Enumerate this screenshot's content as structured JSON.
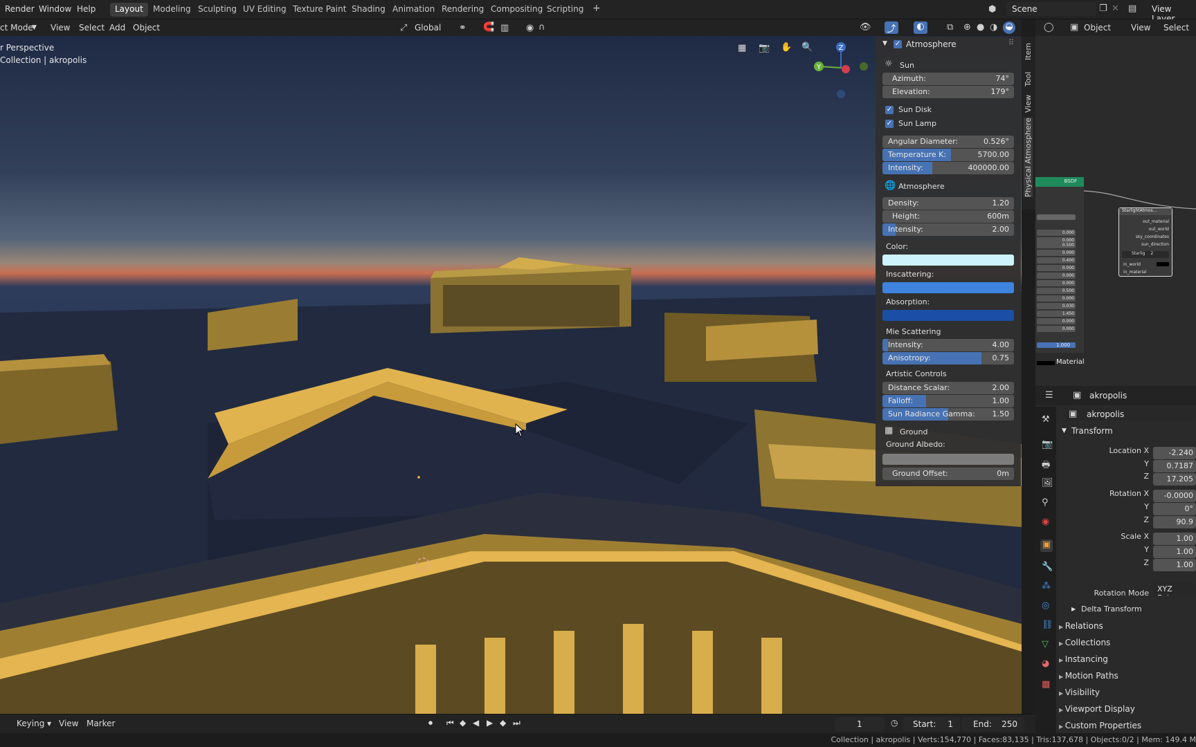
{
  "menu": [
    "Render",
    "Window",
    "Help"
  ],
  "workspaces": [
    "Layout",
    "Modeling",
    "Sculpting",
    "UV Editing",
    "Texture Paint",
    "Shading",
    "Animation",
    "Rendering",
    "Compositing",
    "Scripting"
  ],
  "active_workspace": "Layout",
  "add_tab": "+",
  "scene": {
    "name": "Scene",
    "view_layer": "View Layer"
  },
  "viewport_header": {
    "mode": "ct Mode",
    "menus": [
      "View",
      "Select",
      "Add",
      "Object"
    ],
    "transform": "Global"
  },
  "viewport": {
    "perspective": "r Perspective",
    "collection": "Collection | akropolis"
  },
  "gizmo": {
    "x": "X",
    "y": "Y",
    "z": "Z"
  },
  "npanel": {
    "title": "Atmosphere",
    "sun_header": "Sun",
    "azimuth": {
      "label": "Azimuth:",
      "value": "74°"
    },
    "elevation": {
      "label": "Elevation:",
      "value": "179°"
    },
    "sun_disk": "Sun Disk",
    "sun_lamp": "Sun Lamp",
    "angular_diameter": {
      "label": "Angular Diameter:",
      "value": "0.526°"
    },
    "temperature": {
      "label": "Temperature K:",
      "value": "5700.00",
      "fill": 0.52
    },
    "sun_intensity": {
      "label": "Intensity:",
      "value": "400000.00",
      "fill": 0.38
    },
    "atmosphere_header": "Atmosphere",
    "density": {
      "label": "Density:",
      "value": "1.20"
    },
    "height": {
      "label": "Height:",
      "value": "600m"
    },
    "atm_intensity": {
      "label": "Intensity:",
      "value": "2.00",
      "fill": 0.1
    },
    "color_label": "Color:",
    "color": "#cdf3fc",
    "inscattering_label": "Inscattering:",
    "inscattering": "#3f83e0",
    "absorption_label": "Absorption:",
    "absorption": "#1b4fa6",
    "mie_header": "Mie Scattering",
    "mie_intensity": {
      "label": "Intensity:",
      "value": "4.00",
      "fill": 0.04
    },
    "anisotropy": {
      "label": "Anisotropy:",
      "value": "0.75",
      "fill": 0.75
    },
    "artistic_header": "Artistic Controls",
    "distance_scalar": {
      "label": "Distance Scalar:",
      "value": "2.00"
    },
    "falloff": {
      "label": "Falloff:",
      "value": "1.00",
      "fill": 0.33
    },
    "sun_radiance_gamma": {
      "label": "Sun Radiance Gamma:",
      "value": "1.50",
      "fill": 0.5
    },
    "ground_header": "Ground",
    "ground_albedo_label": "Ground Albedo:",
    "ground_albedo": "#7c7c7c",
    "ground_offset": {
      "label": "Ground Offset:",
      "value": "0m"
    }
  },
  "side_tabs": [
    "Item",
    "Tool",
    "View",
    "Physical Atmosphere"
  ],
  "node_editor": {
    "object_menu": "Object",
    "menus": [
      "View",
      "Select"
    ],
    "node_title": "StarlightAtmos...",
    "outputs": [
      "out_material",
      "out_world",
      "sky_coordinates",
      "sun_direction"
    ],
    "inputs": [
      "in_world",
      "in_material"
    ],
    "node_group": "Starlig",
    "node_users": "2",
    "bsdf_label": "BSDF",
    "material_label": "Material",
    "values": [
      "0.000",
      "0.000",
      "0.500",
      "0.000",
      "0.400",
      "0.000",
      "0.000",
      "0.000",
      "0.500",
      "0.000",
      "0.030",
      "1.450",
      "0.000",
      "0.000",
      "1.000"
    ]
  },
  "properties": {
    "object_name": "akropolis",
    "data_name": "akropolis",
    "transform_header": "Transform",
    "location_x": {
      "label": "Location X",
      "value": "-2.240"
    },
    "location_y": {
      "label": "Y",
      "value": "0.7187"
    },
    "location_z": {
      "label": "Z",
      "value": "17.205"
    },
    "rotation_x": {
      "label": "Rotation X",
      "value": "-0.0000"
    },
    "rotation_y": {
      "label": "Y",
      "value": "0°"
    },
    "rotation_z": {
      "label": "Z",
      "value": "90.9"
    },
    "scale_x": {
      "label": "Scale X",
      "value": "1.00"
    },
    "scale_y": {
      "label": "Y",
      "value": "1.00"
    },
    "scale_z": {
      "label": "Z",
      "value": "1.00"
    },
    "rotation_mode": {
      "label": "Rotation Mode",
      "value": "XYZ Euler"
    },
    "sections": [
      "Delta Transform",
      "Relations",
      "Collections",
      "Instancing",
      "Motion Paths",
      "Visibility",
      "Viewport Display",
      "Custom Properties"
    ]
  },
  "timeline": {
    "keying": "Keying",
    "view": "View",
    "marker": "Marker",
    "current_frame": "1",
    "start_label": "Start:",
    "start": "1",
    "end_label": "End:",
    "end": "250"
  },
  "status_bar": "Collection | akropolis | Verts:154,770 | Faces:83,135 | Tris:137,678 | Objects:0/2 | Mem: 149.4 M"
}
